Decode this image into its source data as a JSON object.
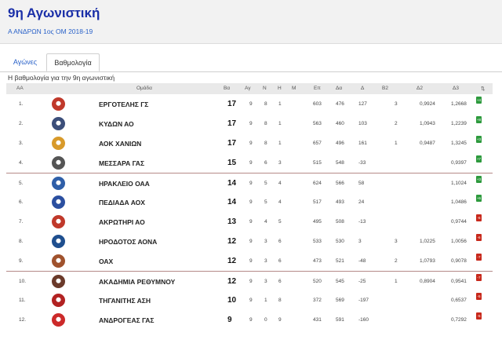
{
  "header": {
    "title": "9η Αγωνιστική",
    "subtitle": "Α ΑΝΔΡΩΝ 1ος ΟΜ 2018-19"
  },
  "tabs": [
    {
      "label": "Αγώνες"
    },
    {
      "label": "Βαθμολογία"
    }
  ],
  "caption": "Η βαθμολογία για την 9η αγωνιστική",
  "columns": [
    "AA",
    "Ομάδα",
    "Βα",
    "Αγ",
    "Ν",
    "Η",
    "Μ",
    "Επ",
    "Δα",
    "Δ",
    "Β2",
    "Δ2",
    "Δ3",
    "⇅"
  ],
  "colors": {
    "up": "#2d9a3d",
    "down": "#c8291c",
    "title": "#1a2fa8",
    "separator": "#b58a88"
  },
  "rows": [
    {
      "pos": "1.",
      "team": "ΕΡΓΟΤΕΛΗΣ ΓΣ",
      "pts": "17",
      "gp": "9",
      "w": "8",
      "l": "1",
      "m": "",
      "ep": "603",
      "da": "476",
      "diff": "127",
      "b2": "3",
      "d2": "0,9924",
      "d3": "1,2668",
      "badge": "+4",
      "trend": "up",
      "logo_color": "#c0392b"
    },
    {
      "pos": "2.",
      "team": "ΚΥΔΩΝ ΑΟ",
      "pts": "17",
      "gp": "9",
      "w": "8",
      "l": "1",
      "m": "",
      "ep": "563",
      "da": "460",
      "diff": "103",
      "b2": "2",
      "d2": "1,0943",
      "d3": "1,2239",
      "badge": "+8",
      "trend": "up",
      "logo_color": "#3c4f7a"
    },
    {
      "pos": "3.",
      "team": "ΑΟΚ ΧΑΝΙΩΝ",
      "pts": "17",
      "gp": "9",
      "w": "8",
      "l": "1",
      "m": "",
      "ep": "657",
      "da": "496",
      "diff": "161",
      "b2": "1",
      "d2": "0,9487",
      "d3": "1,3245",
      "badge": "+3",
      "trend": "up",
      "logo_color": "#d89a2b"
    },
    {
      "pos": "4.",
      "team": "ΜΕΣΣΑΡΑ ΓΑΣ",
      "pts": "15",
      "gp": "9",
      "w": "6",
      "l": "3",
      "m": "",
      "ep": "515",
      "da": "548",
      "diff": "-33",
      "b2": "",
      "d2": "",
      "d3": "0,9397",
      "badge": "+7",
      "trend": "up",
      "logo_color": "#555555"
    },
    {
      "pos": "5.",
      "team": "ΗΡΑΚΛΕΙΟ ΟΑΑ",
      "pts": "14",
      "gp": "9",
      "w": "5",
      "l": "4",
      "m": "",
      "ep": "624",
      "da": "566",
      "diff": "58",
      "b2": "",
      "d2": "",
      "d3": "1,1024",
      "badge": "+3",
      "trend": "up",
      "logo_color": "#2f5fa8"
    },
    {
      "pos": "6.",
      "team": "ΠΕΔΙΑΔΑ ΑΟΧ",
      "pts": "14",
      "gp": "9",
      "w": "5",
      "l": "4",
      "m": "",
      "ep": "517",
      "da": "493",
      "diff": "24",
      "b2": "",
      "d2": "",
      "d3": "1,0486",
      "badge": "+6",
      "trend": "up",
      "logo_color": "#2b4fa0"
    },
    {
      "pos": "7.",
      "team": "ΑΚΡΩΤΗΡΙ ΑΟ",
      "pts": "13",
      "gp": "9",
      "w": "4",
      "l": "5",
      "m": "",
      "ep": "495",
      "da": "508",
      "diff": "-13",
      "b2": "",
      "d2": "",
      "d3": "0,9744",
      "badge": "-6",
      "trend": "down",
      "logo_color": "#c0392b"
    },
    {
      "pos": "8.",
      "team": "ΗΡΟΔΟΤΟΣ ΑΟΝΑ",
      "pts": "12",
      "gp": "9",
      "w": "3",
      "l": "6",
      "m": "",
      "ep": "533",
      "da": "530",
      "diff": "3",
      "b2": "3",
      "d2": "1,0225",
      "d3": "1,0056",
      "badge": "-6",
      "trend": "down",
      "logo_color": "#1f4f8f"
    },
    {
      "pos": "9.",
      "team": "ΟΑΧ",
      "pts": "12",
      "gp": "9",
      "w": "3",
      "l": "6",
      "m": "",
      "ep": "473",
      "da": "521",
      "diff": "-48",
      "b2": "2",
      "d2": "1,0793",
      "d3": "0,9078",
      "badge": "-7",
      "trend": "down",
      "logo_color": "#a0522d"
    },
    {
      "pos": "10.",
      "team": "ΑΚΑΔΗΜΙΑ ΡΕΘΥΜΝΟΥ",
      "pts": "12",
      "gp": "9",
      "w": "3",
      "l": "6",
      "m": "",
      "ep": "520",
      "da": "545",
      "diff": "-25",
      "b2": "1",
      "d2": "0,8904",
      "d3": "0,9541",
      "badge": "-7",
      "trend": "down",
      "logo_color": "#6b3a2a"
    },
    {
      "pos": "11.",
      "team": "ΤΗΓΑΝΙΤΗΣ ΑΣΗ",
      "pts": "10",
      "gp": "9",
      "w": "1",
      "l": "8",
      "m": "",
      "ep": "372",
      "da": "569",
      "diff": "-197",
      "b2": "",
      "d2": "",
      "d3": "0,6537",
      "badge": "-5",
      "trend": "down",
      "logo_color": "#b22222"
    },
    {
      "pos": "12.",
      "team": "ΑΝΔΡΟΓΕΑΣ ΓΑΣ",
      "pts": "9",
      "gp": "9",
      "w": "0",
      "l": "9",
      "m": "",
      "ep": "431",
      "da": "591",
      "diff": "-160",
      "b2": "",
      "d2": "",
      "d3": "0,7292",
      "badge": "-5",
      "trend": "down",
      "logo_color": "#cc2a2a"
    }
  ]
}
